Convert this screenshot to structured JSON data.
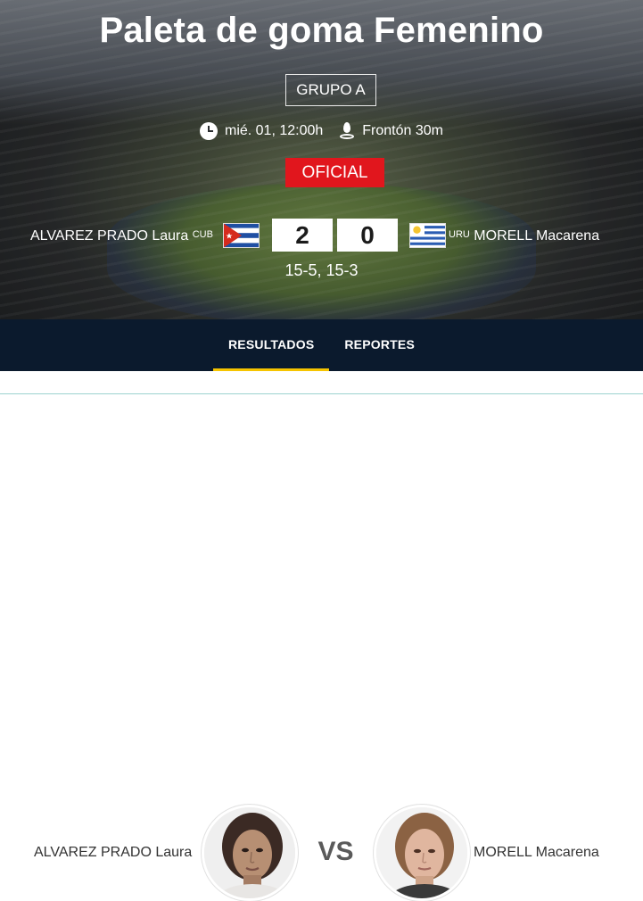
{
  "event": {
    "title": "Paleta de goma Femenino",
    "group": "GRUPO A",
    "datetime": "mié. 01, 12:00h",
    "venue": "Frontón 30m",
    "status": "OFICIAL"
  },
  "match": {
    "home": {
      "name": "ALVAREZ PRADO Laura",
      "code": "CUB",
      "score": "2"
    },
    "away": {
      "name": "MORELL Macarena",
      "code": "URU",
      "score": "0"
    },
    "sets": "15-5, 15-3"
  },
  "tabs": [
    {
      "label": "RESULTADOS",
      "active": true
    },
    {
      "label": "REPORTES",
      "active": false
    }
  ],
  "versus": {
    "left_name": "ALVAREZ PRADO Laura",
    "vs_label": "VS",
    "right_name": "MORELL Macarena"
  },
  "colors": {
    "status_red": "#e1161d",
    "tab_bar": "#0b1a2d",
    "tab_active_underline": "#f6c400"
  },
  "icons": {
    "clock": "clock-icon",
    "venue": "location-pin-icon",
    "home_flag": "cuba-flag-icon",
    "away_flag": "uruguay-flag-icon"
  }
}
